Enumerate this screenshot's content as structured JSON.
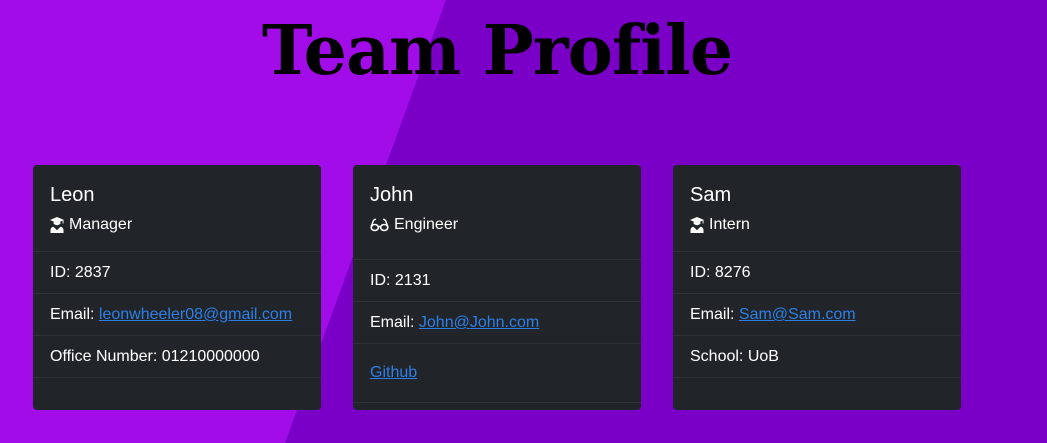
{
  "page": {
    "title": "Team Profile"
  },
  "employees": [
    {
      "name": "Leon",
      "role": "Manager",
      "role_icon": "user-graduate-icon",
      "id_text": "ID: 2837",
      "email_prefix": "Email: ",
      "email": "leonwheeler08@gmail.com",
      "extra_text": "Office Number: 01210000000"
    },
    {
      "name": "John",
      "role": "Engineer",
      "role_icon": "glasses-icon",
      "id_text": "ID: 2131",
      "email_prefix": "Email: ",
      "email": "John@John.com",
      "extra_link": "Github"
    },
    {
      "name": "Sam",
      "role": "Intern",
      "role_icon": "user-graduate-icon",
      "id_text": "ID: 8276",
      "email_prefix": "Email: ",
      "email": "Sam@Sam.com",
      "extra_text": "School: UoB"
    }
  ],
  "colors": {
    "background_left": "#a20ce9",
    "background_right": "#7a00c8",
    "card": "#212529",
    "link": "#2d7fe8"
  }
}
